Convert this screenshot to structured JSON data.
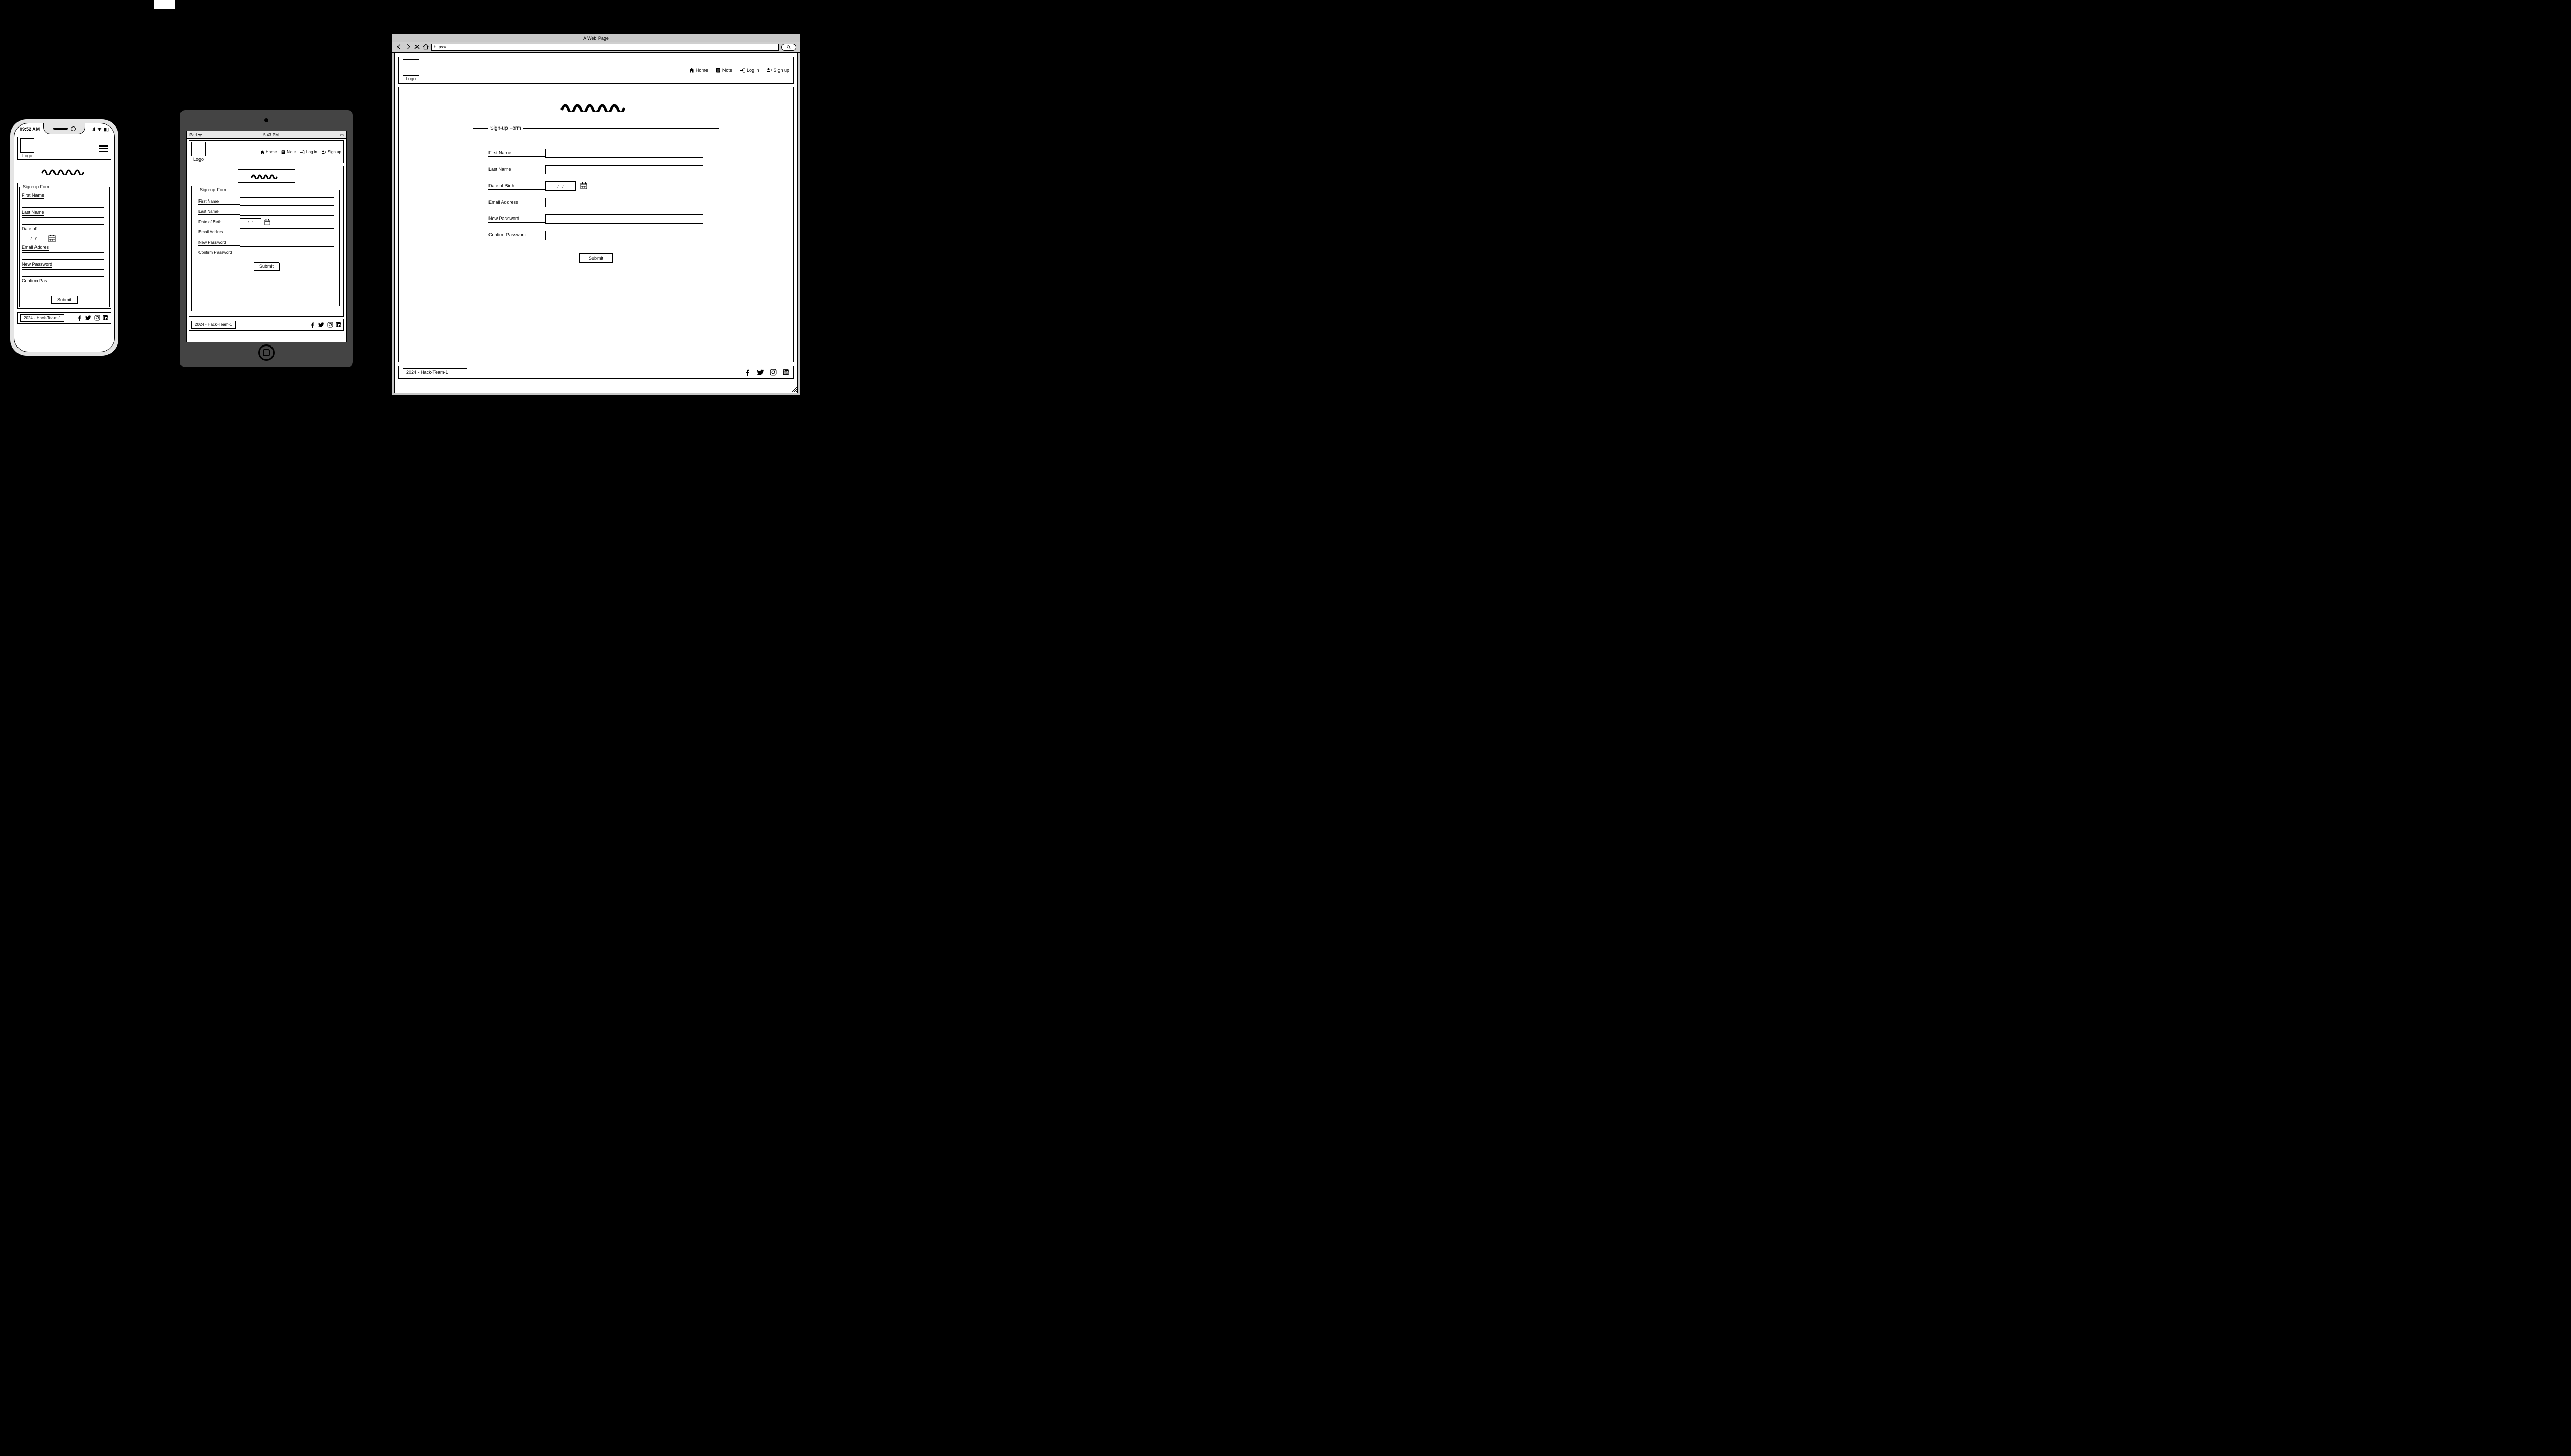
{
  "logo_label": "Logo",
  "nav": {
    "home": "Home",
    "note": "Note",
    "login": "Log in",
    "signup": "Sign up"
  },
  "form": {
    "legend": "Sign-up Form",
    "first_name": "First Name",
    "last_name": "Last Name",
    "dob": "Date of Birth",
    "dob_short": "Date of",
    "dob_value": "/   /",
    "email": "Email Address",
    "email_short": "Email Addres",
    "new_password": "New Password",
    "confirm_password": "Confirm Password",
    "confirm_short": "Confirm Pas",
    "submit": "Submit"
  },
  "footer": {
    "copyright": "2024 - Hack-Team-1"
  },
  "phone": {
    "time": "09:52 AM",
    "signal": "📶",
    "wifi": "📡",
    "battery": "🔋"
  },
  "tablet": {
    "carrier": "iPad",
    "time": "5:43 PM",
    "wifi_icon": "📶",
    "battery_icon": "🔋"
  },
  "browser": {
    "title": "A Web Page",
    "url": "https://"
  }
}
